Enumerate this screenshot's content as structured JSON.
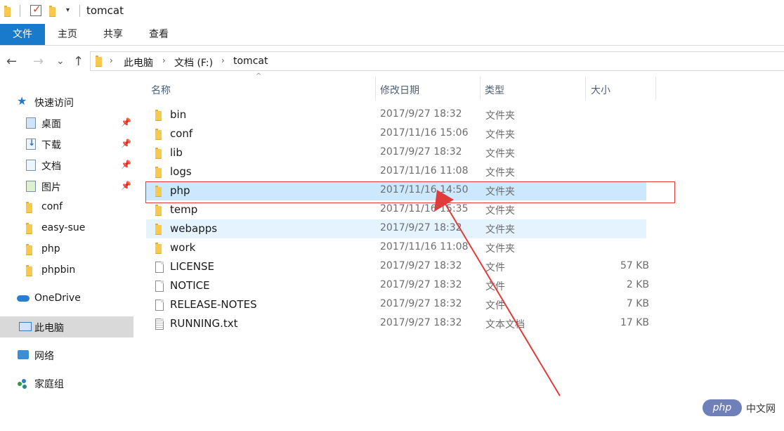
{
  "window": {
    "title": "tomcat",
    "quick_access_toolbar": [
      "folder-icon",
      "properties-check-icon",
      "new-folder-icon",
      "dropdown-icon"
    ],
    "check_glyph": "✓",
    "dropdown_glyph": "▾"
  },
  "ribbon": {
    "tabs": [
      {
        "label": "文件",
        "active": true
      },
      {
        "label": "主页"
      },
      {
        "label": "共享"
      },
      {
        "label": "查看"
      }
    ]
  },
  "navigation": {
    "back_glyph": "←",
    "forward_glyph": "→",
    "recent_glyph": "⌄",
    "up_glyph": "↑",
    "breadcrumb": [
      "此电脑",
      "文档 (F:)",
      "tomcat"
    ],
    "separator_glyph": "›"
  },
  "sidebar": {
    "pin_glyph": "📌",
    "quick_access_label": "快速访问",
    "quick_access_items": [
      {
        "label": "桌面",
        "icon": "desktop-icon",
        "pinned": true
      },
      {
        "label": "下载",
        "icon": "download-icon",
        "pinned": true
      },
      {
        "label": "文档",
        "icon": "documents-icon",
        "pinned": true
      },
      {
        "label": "图片",
        "icon": "pictures-icon",
        "pinned": true
      },
      {
        "label": "conf",
        "icon": "folder-icon",
        "pinned": false
      },
      {
        "label": "easy-sue",
        "icon": "folder-icon",
        "pinned": false
      },
      {
        "label": "php",
        "icon": "folder-icon",
        "pinned": false
      },
      {
        "label": "phpbin",
        "icon": "folder-icon",
        "pinned": false
      }
    ],
    "onedrive_label": "OneDrive",
    "this_pc_label": "此电脑",
    "network_label": "网络",
    "homegroup_label": "家庭组",
    "selected": "此电脑"
  },
  "columns": {
    "name": "名称",
    "date_modified": "修改日期",
    "type": "类型",
    "size": "大小",
    "sort_glyph": "^"
  },
  "files": [
    {
      "name": "bin",
      "date": "2017/9/27 18:32",
      "type": "文件夹",
      "size": "",
      "icon": "folder-icon"
    },
    {
      "name": "conf",
      "date": "2017/11/16 15:06",
      "type": "文件夹",
      "size": "",
      "icon": "folder-icon"
    },
    {
      "name": "lib",
      "date": "2017/9/27 18:32",
      "type": "文件夹",
      "size": "",
      "icon": "folder-icon"
    },
    {
      "name": "logs",
      "date": "2017/11/16 11:08",
      "type": "文件夹",
      "size": "",
      "icon": "folder-icon"
    },
    {
      "name": "php",
      "date": "2017/11/16 14:50",
      "type": "文件夹",
      "size": "",
      "icon": "folder-icon",
      "state": "selected"
    },
    {
      "name": "temp",
      "date": "2017/11/16 15:35",
      "type": "文件夹",
      "size": "",
      "icon": "folder-icon"
    },
    {
      "name": "webapps",
      "date": "2017/9/27 18:32",
      "type": "文件夹",
      "size": "",
      "icon": "folder-icon",
      "state": "hover"
    },
    {
      "name": "work",
      "date": "2017/11/16 11:08",
      "type": "文件夹",
      "size": "",
      "icon": "folder-icon"
    },
    {
      "name": "LICENSE",
      "date": "2017/9/27 18:32",
      "type": "文件",
      "size": "57 KB",
      "icon": "file-icon"
    },
    {
      "name": "NOTICE",
      "date": "2017/9/27 18:32",
      "type": "文件",
      "size": "2 KB",
      "icon": "file-icon"
    },
    {
      "name": "RELEASE-NOTES",
      "date": "2017/9/27 18:32",
      "type": "文件",
      "size": "7 KB",
      "icon": "file-icon"
    },
    {
      "name": "RUNNING.txt",
      "date": "2017/9/27 18:32",
      "type": "文本文档",
      "size": "17 KB",
      "icon": "text-file-icon"
    }
  ],
  "annotation": {
    "color": "#e23b3b"
  },
  "colors": {
    "accent": "#1979ca",
    "selected_row": "#cce8ff",
    "hover_row": "#e5f3ff",
    "folder": "#f7c94f"
  },
  "watermark": {
    "logo": "php",
    "text": "中文网"
  }
}
